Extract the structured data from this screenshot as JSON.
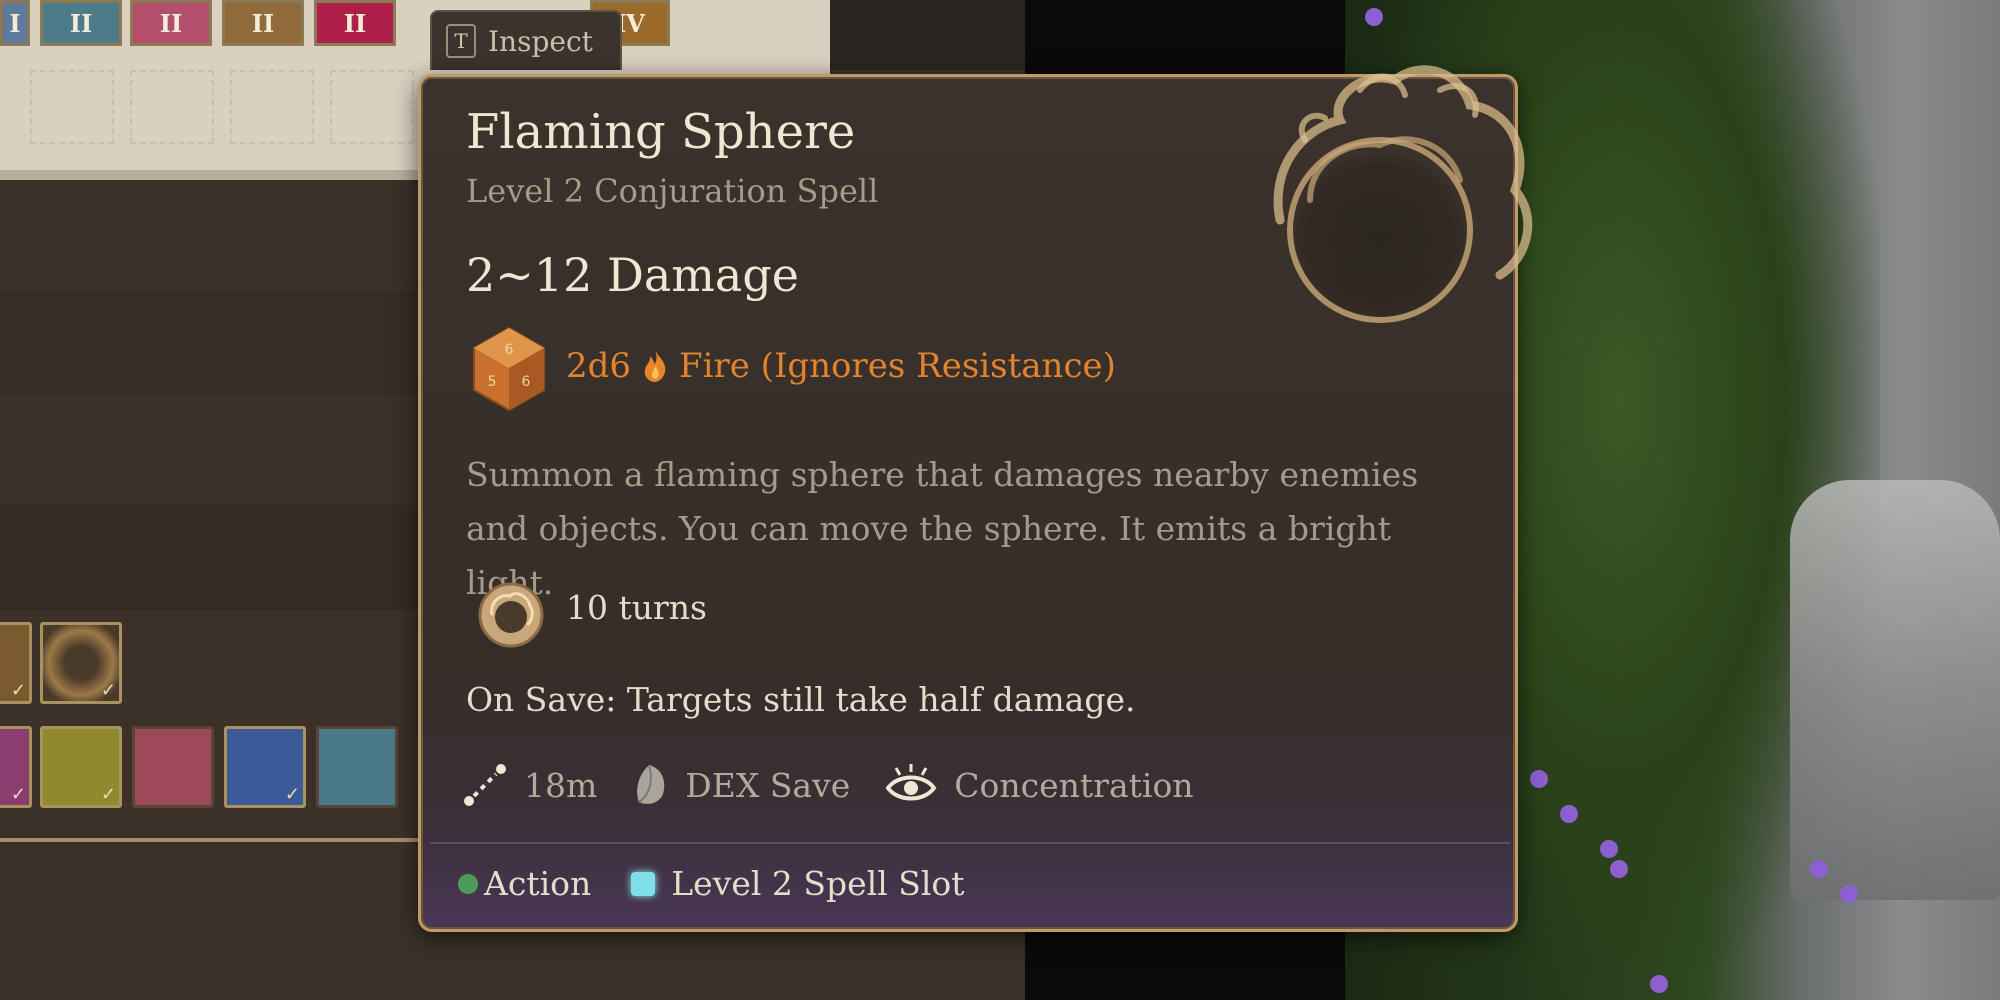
{
  "inspect": {
    "key": "T",
    "label": "Inspect"
  },
  "top_bar": {
    "icons": [
      "I",
      "II",
      "II",
      "II",
      "II",
      "IV"
    ]
  },
  "tooltip": {
    "title": "Flaming Sphere",
    "subtitle": "Level 2 Conjuration Spell",
    "damage_range": "2~12 Damage",
    "damage_dice": "2d6",
    "damage_type": "Fire (Ignores Resistance)",
    "description": "Summon a flaming sphere that damages nearby enemies and objects. You can move the sphere. It emits a bright light.",
    "duration": "10 turns",
    "on_save": "On Save: Targets still take half damage.",
    "range": "18m",
    "save": "DEX Save",
    "concentration": "Concentration",
    "cost_action": "Action",
    "cost_slot": "Level 2 Spell Slot"
  },
  "colors": {
    "fire": "#e2842f",
    "action": "#4e9a57",
    "spell_slot": "#7fe0ea",
    "border": "#c29a6a"
  },
  "icons": [
    "inspect-key-icon",
    "sphere-emblem-icon",
    "dice-icon",
    "flame-icon",
    "turns-icon",
    "range-icon",
    "dex-save-icon",
    "concentration-icon"
  ]
}
